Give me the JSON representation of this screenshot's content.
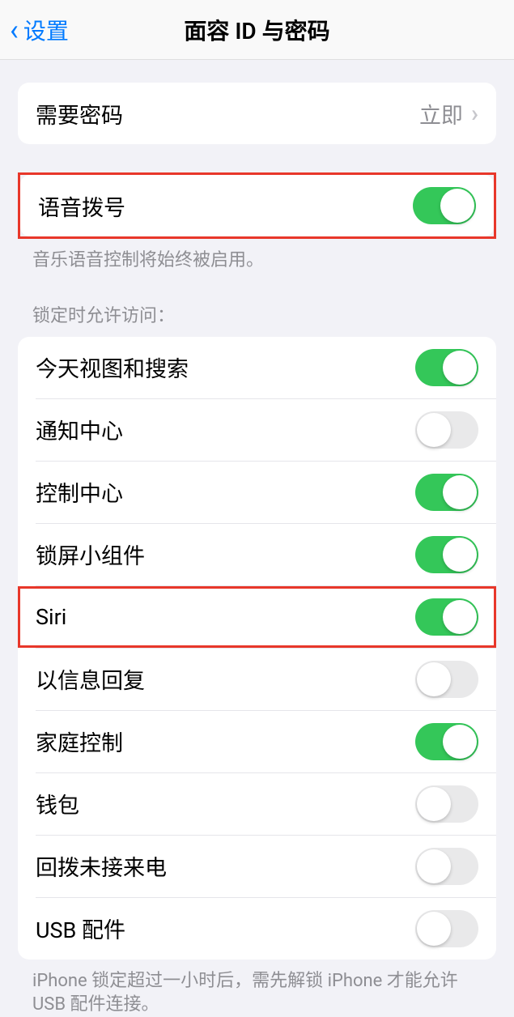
{
  "header": {
    "back_label": "设置",
    "title": "面容 ID 与密码"
  },
  "passcode_section": {
    "require_passcode_label": "需要密码",
    "require_passcode_value": "立即"
  },
  "voice_dial": {
    "label": "语音拨号",
    "enabled": true,
    "footer": "音乐语音控制将始终被启用。"
  },
  "lock_access": {
    "header": "锁定时允许访问：",
    "items": [
      {
        "label": "今天视图和搜索",
        "enabled": true
      },
      {
        "label": "通知中心",
        "enabled": false
      },
      {
        "label": "控制中心",
        "enabled": true
      },
      {
        "label": "锁屏小组件",
        "enabled": true
      },
      {
        "label": "Siri",
        "enabled": true
      },
      {
        "label": "以信息回复",
        "enabled": false
      },
      {
        "label": "家庭控制",
        "enabled": true
      },
      {
        "label": "钱包",
        "enabled": false
      },
      {
        "label": "回拨未接来电",
        "enabled": false
      },
      {
        "label": "USB 配件",
        "enabled": false
      }
    ],
    "footer": "iPhone 锁定超过一小时后，需先解锁 iPhone 才能允许USB 配件连接。"
  },
  "highlighted_rows": [
    0,
    4
  ]
}
